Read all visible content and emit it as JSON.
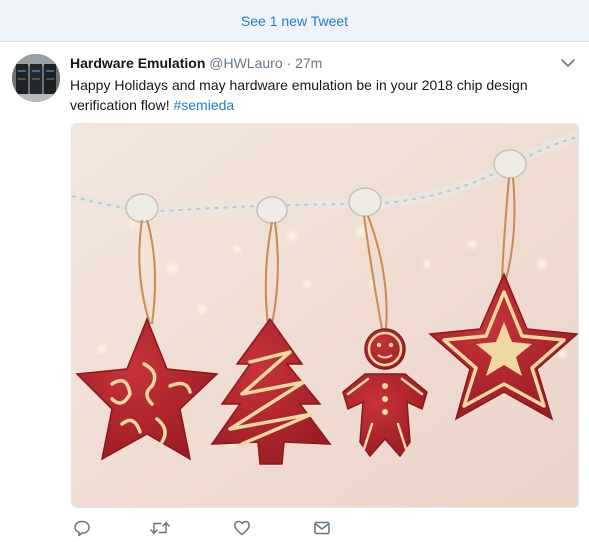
{
  "timeline": {
    "new_tweets_label": "See 1 new Tweet"
  },
  "tweet": {
    "author_name": "Hardware Emulation",
    "author_handle": "@HWLauro",
    "separator": "·",
    "timestamp": "27m",
    "text_before_hashtag": "Happy Holidays and may hardware emulation be in your 2018 chip design verification flow! ",
    "hashtag": "#semieda"
  },
  "icons": {
    "caret": "chevron-down-icon",
    "reply": "reply-icon",
    "retweet": "retweet-icon",
    "like": "heart-icon",
    "dm": "envelope-icon"
  },
  "colors": {
    "accent": "#1d7ec6",
    "new_tweet_bar_bg": "#eef3f8",
    "muted": "#657786",
    "text": "#14171a"
  }
}
